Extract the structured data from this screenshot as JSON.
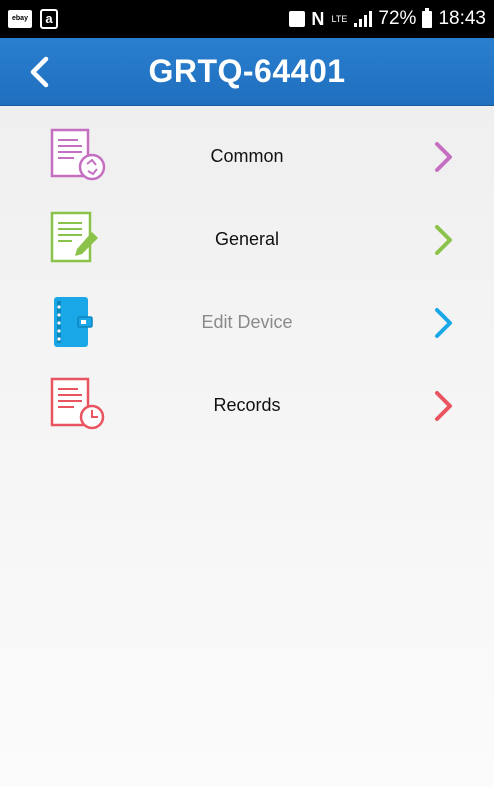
{
  "status_bar": {
    "left_icons": [
      "ebay-icon",
      "amazon-icon"
    ],
    "ebay_label": "ebay",
    "amazon_label": "a",
    "nfc_label": "N",
    "lte_label": "LTE",
    "battery": "72%",
    "time": "18:43"
  },
  "header": {
    "title": "GRTQ-64401",
    "back_icon": "chevron-left-icon"
  },
  "menu": {
    "items": [
      {
        "label": "Common",
        "icon": "document-recycle-icon",
        "color": "#c56fc0"
      },
      {
        "label": "General",
        "icon": "document-edit-icon",
        "color": "#8bc34a"
      },
      {
        "label": "Edit Device",
        "icon": "notebook-icon",
        "color": "#19a7e8"
      },
      {
        "label": "Records",
        "icon": "document-clock-icon",
        "color": "#e8545f"
      }
    ]
  },
  "colors": {
    "header": "#2277c6",
    "status_bar": "#000000",
    "background": "#f3f3f3"
  }
}
